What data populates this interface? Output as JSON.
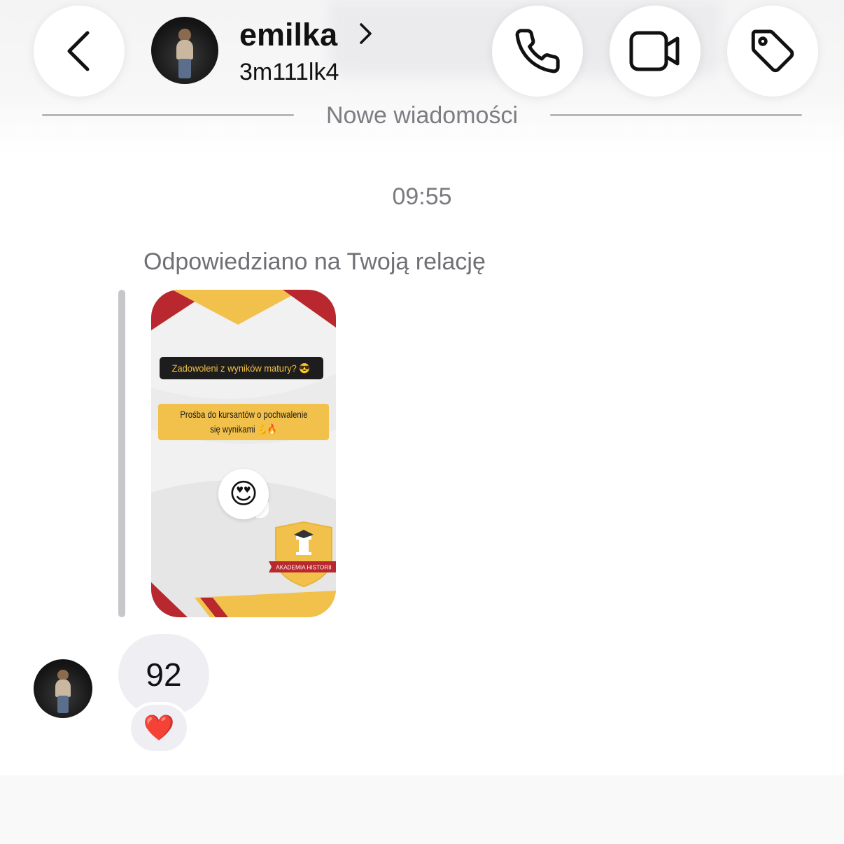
{
  "header": {
    "contact_name": "emilka",
    "contact_handle": "3m111lk4",
    "back_icon": "chevron-left-icon",
    "name_chevron_icon": "chevron-right-icon",
    "call_icon": "phone-icon",
    "video_icon": "video-camera-icon",
    "tag_icon": "tag-icon"
  },
  "divider": {
    "label": "Nowe wiadomości"
  },
  "conversation": {
    "timestamp": "09:55",
    "reply_label": "Odpowiedziano na Twoją relację",
    "story": {
      "question_sticker": "Zadowoleni z wyników matury? 😎",
      "request_line1": "Prośba do kursantów o pochwalenie",
      "request_line2": "się wynikami 💪🔥",
      "reaction_emoji": "😍",
      "badge_text": "AKADEMIA HISTORII",
      "colors": {
        "red": "#b8282e",
        "yellow": "#f2c14c",
        "dark": "#1d1d1d"
      }
    },
    "message": {
      "text": "92",
      "reaction": "❤️"
    }
  }
}
